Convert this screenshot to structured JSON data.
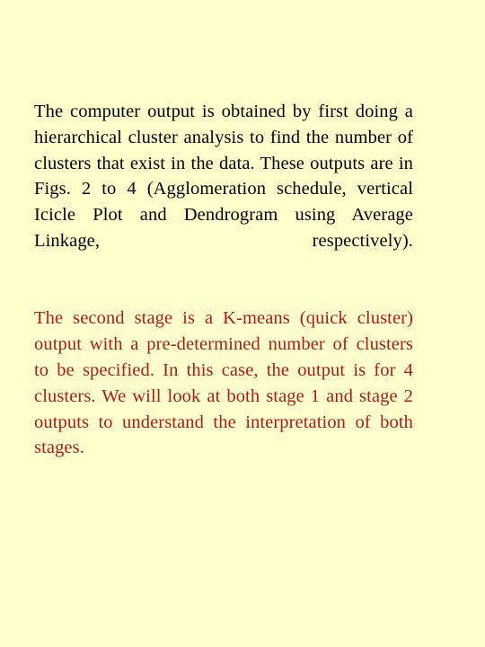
{
  "slide": {
    "background_color": "#FFFFCC",
    "body": {
      "paragraphs": [
        {
          "id": "paragraph-hierarchical-cluster",
          "color": "#000000",
          "text": "The computer output is obtained by first doing a hierarchical cluster analysis to find the number of clusters that exist in the data. These outputs are in Figs. 2 to 4 (Agglomeration schedule, vertical Icicle Plot and Dendrogram using Average Linkage, respectively)."
        },
        {
          "id": "paragraph-kmeans-stage",
          "color": "#A91C1C",
          "text": "The second stage is a K-means (quick cluster) output with a pre-determined number of clusters to be specified. In this case, the output is for 4 clusters. We will look at both stage 1 and stage 2 outputs to understand the interpretation of both stages."
        }
      ]
    }
  }
}
